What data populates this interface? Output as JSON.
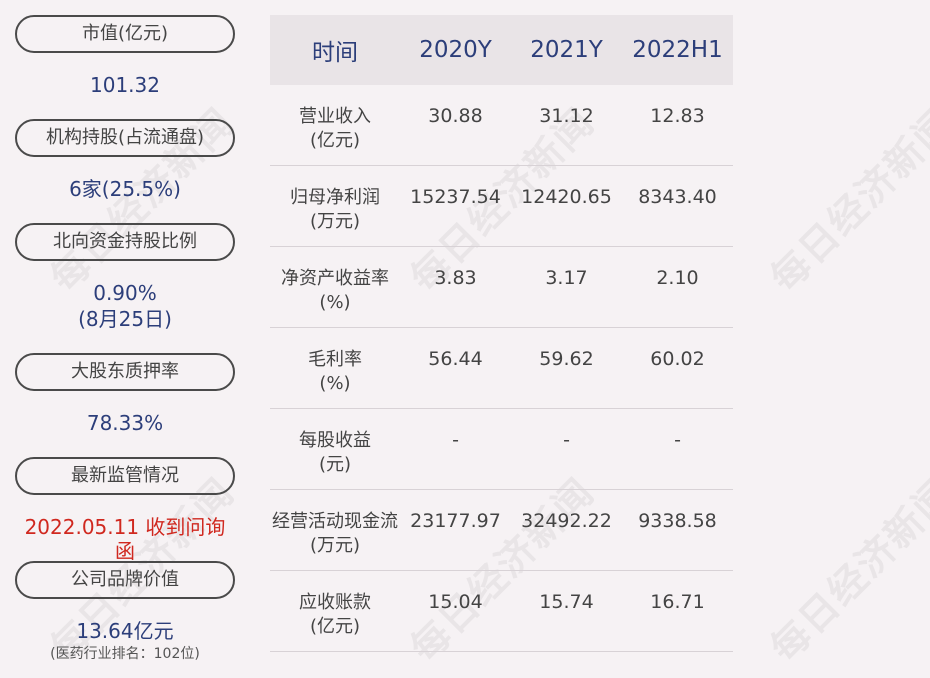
{
  "watermark": "每日经济新闻",
  "left": {
    "items": [
      {
        "label": "市值(亿元)",
        "value": "101.32"
      },
      {
        "label": "机构持股(占流通盘)",
        "value": "6家(25.5%)"
      },
      {
        "label": "北向资金持股比例",
        "value": "0.90%",
        "value2": "(8月25日)"
      },
      {
        "label": "大股东质押率",
        "value": "78.33%"
      },
      {
        "label": "最新监管情况",
        "value": "2022.05.11 收到问询函"
      },
      {
        "label": "公司品牌价值",
        "value": "13.64亿元",
        "value2": "(医药行业排名：102位)"
      }
    ]
  },
  "table": {
    "headers": [
      "时间",
      "2020Y",
      "2021Y",
      "2022H1"
    ],
    "rows": [
      {
        "label": "营业收入",
        "unit": "(亿元)",
        "values": [
          "30.88",
          "31.12",
          "12.83"
        ]
      },
      {
        "label": "归母净利润",
        "unit": "(万元)",
        "values": [
          "15237.54",
          "12420.65",
          "8343.40"
        ]
      },
      {
        "label": "净资产收益率",
        "unit": "(%)",
        "values": [
          "3.83",
          "3.17",
          "2.10"
        ]
      },
      {
        "label": "毛利率",
        "unit": "(%)",
        "values": [
          "56.44",
          "59.62",
          "60.02"
        ]
      },
      {
        "label": "每股收益",
        "unit": "(元)",
        "values": [
          "-",
          "-",
          "-"
        ]
      },
      {
        "label": "经营活动现金流",
        "unit": "(万元)",
        "values": [
          "23177.97",
          "32492.22",
          "9338.58"
        ]
      },
      {
        "label": "应收账款",
        "unit": "(亿元)",
        "values": [
          "15.04",
          "15.74",
          "16.71"
        ]
      }
    ]
  },
  "colors": {
    "background": "#f6f2f4",
    "value_blue": "#2c3e7a",
    "alert_red": "#d0281f",
    "header_bg": "#e9e4e7"
  }
}
